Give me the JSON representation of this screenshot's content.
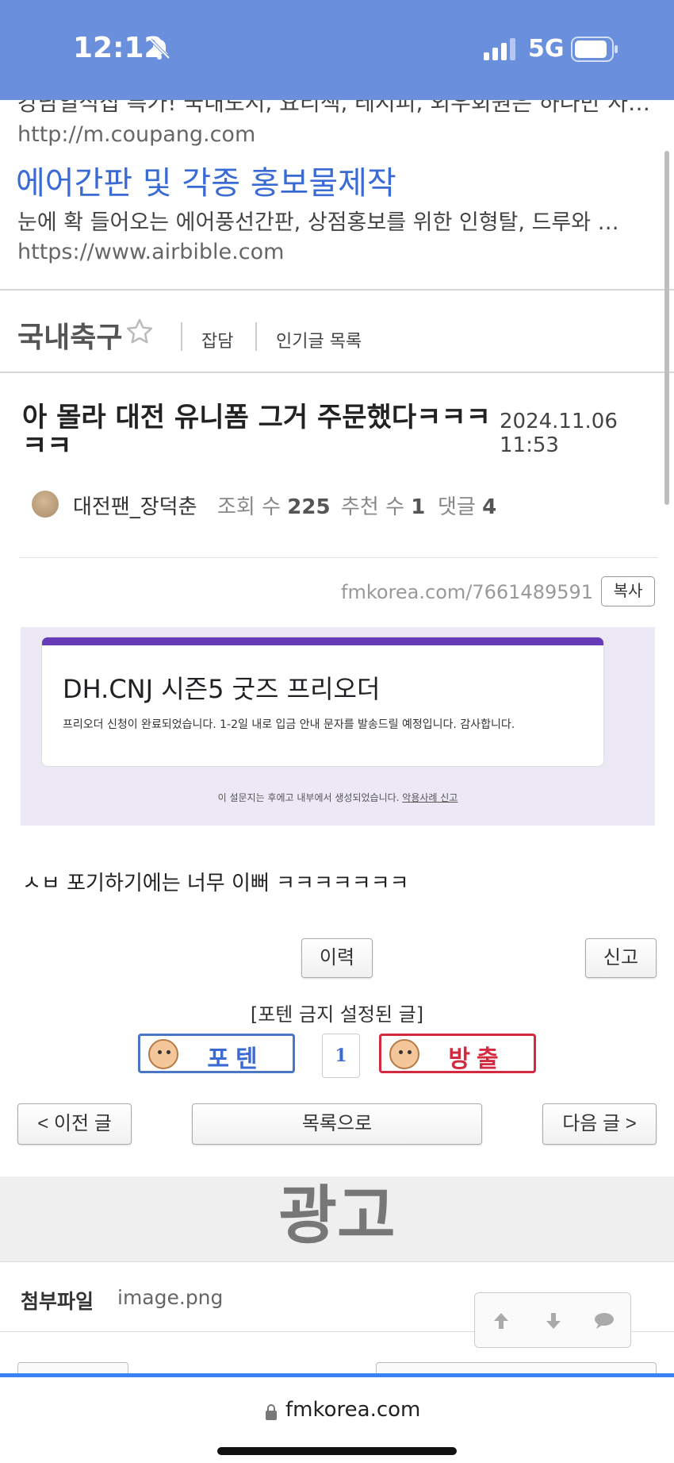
{
  "status_bar": {
    "time": "12:12",
    "network": "5G"
  },
  "ads": {
    "cut_text": "강남일식집 특가! 국내도서, 요리책, 레시피, 외우회원은 하나만 사…",
    "url_1": "http://m.coupang.com",
    "title": "에어간판 및 각종 홍보물제작",
    "desc": "눈에 확 들어오는 에어풍선간판, 상점홍보를 위한 인형탈, 드루와 …",
    "url_2": "https://www.airbible.com"
  },
  "board": {
    "name": "국내축구",
    "link_1": "잡담",
    "link_2": "인기글 목록"
  },
  "post": {
    "title": "아 몰라 대전 유니폼 그거 주문했다ㅋㅋㅋㅋㅋ",
    "date": "2024.11.06 11:53",
    "author": "대전팬_장덕춘",
    "views_label": "조회 수",
    "views": "225",
    "recommends_label": "추천 수",
    "recommends": "1",
    "comments_label": "댓글",
    "comments": "4",
    "url": "fmkorea.com/7661489591",
    "copy_label": "복사",
    "body": "ㅅㅂ 포기하기에는 너무 이뻐 ㅋㅋㅋㅋㅋㅋㅋ"
  },
  "embed": {
    "form_title": "DH.CNJ 시즌5 굿즈 프리오더",
    "form_message": "프리오더 신청이 완료되었습니다. 1-2일 내로 입금 안내 문자를 발송드릴 예정입니다. 감사합니다.",
    "footer_text": "이 설문지는 후에고 내부에서 생성되었습니다.",
    "footer_link": "악용사례 신고"
  },
  "actions": {
    "history": "이력",
    "report": "신고",
    "lock_note": "[포텐 금지 설정된 글]",
    "vote_up": "포텐",
    "vote_count": "1",
    "vote_down": "방출",
    "prev": "< 이전 글",
    "list": "목록으로",
    "next": "다음 글 >"
  },
  "ad_banner": "광고",
  "attachment": {
    "label": "첨부파일",
    "file": "image.png"
  },
  "browser": {
    "domain": "fmkorea.com"
  },
  "colors": {
    "status_bar": "#6a8fdc",
    "link": "#3a6bd4",
    "downvote": "#d42a40",
    "url_bar_accent": "#3b82f6"
  }
}
